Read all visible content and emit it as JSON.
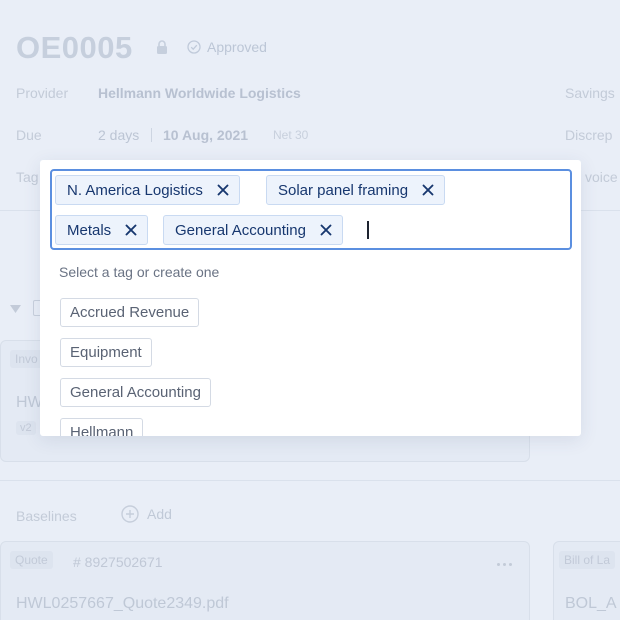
{
  "page": {
    "title": "OE0005",
    "status": "Approved",
    "provider_label": "Provider",
    "provider_value": "Hellmann Worldwide Logistics",
    "due_label": "Due",
    "due_relative": "2 days",
    "due_date": "10 Aug, 2021",
    "due_terms": "Net 30",
    "tags_label": "Tag",
    "right_labels": [
      "Savings",
      "Discrep",
      "voice"
    ],
    "invoice_label": "Invo",
    "invoice_name": "HWl",
    "invoice_version": "v2",
    "baselines_label": "Baselines",
    "add_label": "Add",
    "quote_tag": "Quote",
    "quote_number": "# 8927502671",
    "quote_file": "HWL0257667_Quote2349.pdf",
    "bill_label": "Bill of La",
    "bill_file": "BOL_A"
  },
  "tag_picker": {
    "selected": [
      "N. America Logistics",
      "Solar panel framing",
      "Metals",
      "General Accounting"
    ],
    "hint": "Select a tag or create one",
    "options": [
      "Accrued Revenue",
      "Equipment",
      "General Accounting",
      "Hellmann"
    ]
  }
}
